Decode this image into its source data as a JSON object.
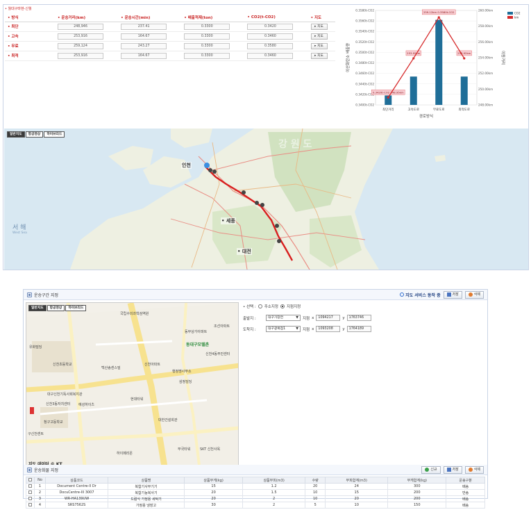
{
  "top": {
    "caption": "• 월대구마현-신월",
    "route_table": {
      "headers": [
        "• 방식",
        "• 운송거리(km)",
        "• 운송시간(min)",
        "• 배출적재(ton)",
        "• CO2(t-CO2)",
        "• 지도"
      ],
      "rows": [
        {
          "mode": "• 최단",
          "distance": "248,946",
          "time": "237.41",
          "load": "0.3300",
          "co2": "0.3420",
          "map": "▸ 지도"
        },
        {
          "mode": "• 고속",
          "distance": "253,916",
          "time": "164.67",
          "load": "0.3300",
          "co2": "0.3460",
          "map": "▸ 지도"
        },
        {
          "mode": "• 무료",
          "distance": "259,124",
          "time": "243.27",
          "load": "0.3300",
          "co2": "0.3580",
          "map": "▸ 지도"
        },
        {
          "mode": "• 최적",
          "distance": "253,916",
          "time": "164.67",
          "load": "0.3300",
          "co2": "0.3460",
          "map": "▸ 지도"
        }
      ]
    },
    "map_tabs": [
      "일반지도",
      "항공영상",
      "하이브리드"
    ],
    "map_labels": {
      "sea": "서 해",
      "sea_en": "West Sea",
      "incheon": "인천",
      "sejong": "• 세종",
      "daejeon": "• 대전",
      "watermark": "강 원 도"
    }
  },
  "chart_data": {
    "type": "bar",
    "categories": [
      "최단거리",
      "고속도로",
      "무료도로",
      "최적도로"
    ],
    "series": [
      {
        "name": "CO2",
        "type": "bar",
        "values": [
          0.342,
          0.346,
          0.358,
          0.346
        ],
        "color": "#1f6e98"
      },
      {
        "name": "km",
        "type": "line",
        "values": [
          248.946,
          253.916,
          259.124,
          253.916
        ],
        "color": "#d62728"
      }
    ],
    "xlabel": "경로방식",
    "ylabel": "이산화탄소 배출량",
    "y2label": "이동거리",
    "ylim": [
      0.34,
      0.36
    ],
    "y2lim": [
      248,
      260
    ],
    "yticks": [
      "0.3400t-CO2",
      "0.3420t-CO2",
      "0.3440t-CO2",
      "0.3460t-CO2",
      "0.3480t-CO2",
      "0.3500t-CO2",
      "0.3520t-CO2",
      "0.3540t-CO2",
      "0.3560t-CO2",
      "0.3580t-CO2"
    ],
    "y2ticks": [
      "248.00km",
      "250.00km",
      "252.00km",
      "254.00km",
      "256.00km",
      "258.00km",
      "260.00km"
    ],
    "data_labels": [
      "0.3420t-CO2 248.95km",
      "253.92km",
      "259.12km 0.3580t-CO2",
      "253.92km"
    ],
    "legend": [
      "CO2",
      "km"
    ],
    "legend_position": "top-right"
  },
  "route_section": {
    "title": "운송구간 지정",
    "sync_label": "지도 서비스 동작 중",
    "save_btn": "저장",
    "delete_btn": "삭제",
    "select_label": "• 선택 :",
    "radio_address": "주소지정",
    "radio_point": "지점지정",
    "origin_label": "출발지 :",
    "origin_select": "대구가창면",
    "origin_point": "지점",
    "origin_x": "1094217",
    "origin_y": "1763746",
    "dest_label": "도착지 :",
    "dest_select": "대구광복점1",
    "dest_point": "지점",
    "dest_x": "1093208",
    "dest_y": "1764189",
    "x_prefix": "x",
    "y_prefix": "y",
    "map_tabs": [
      "일반지도",
      "항공영상",
      "하이브리드"
    ],
    "copyright": "지도 데이터 © KT",
    "map_labels": [
      "동대구모텔촌",
      "유화빌딩",
      "신천초등학교",
      "대구신천기독사회복지관",
      "신천3동자치센터",
      "청구고등학교",
      "예성하이츠",
      "현대타워",
      "대한건설회관",
      "SKT 신천사옥",
      "부국타워",
      "하이페리온",
      "백산송센스빌",
      "국립수의과학검역원",
      "신천4동주민센터",
      "동부상가아파트",
      "조선아파트",
      "신천아파트",
      "행정명사무소",
      "삼정빌딩",
      "구신천센트"
    ]
  },
  "goods_section": {
    "title": "운송화물 지정",
    "new_btn": "신규",
    "save_btn": "저장",
    "delete_btn": "삭제",
    "headers": [
      "No",
      "상품코드",
      "상품명",
      "상품무게(kg)",
      "상품부피(m3)",
      "수량",
      "부피합계(m3)",
      "무게합계(kg)",
      "운송구분"
    ],
    "rows": [
      [
        "1",
        "Document Centre-II Dr",
        "복합기사무기기",
        "15",
        "1.2",
        "20",
        "24",
        "300",
        "배송"
      ],
      [
        "2",
        "DocuCentre-III 3007",
        "복합기능복사기",
        "20",
        "1.5",
        "10",
        "15",
        "200",
        "반송"
      ],
      [
        "3",
        "WR-HA139UW",
        "드럼식 가정용 세탁기",
        "20",
        "2",
        "10",
        "20",
        "200",
        "배송"
      ],
      [
        "4",
        "SRS7562S",
        "가정용 냉장고",
        "30",
        "2",
        "5",
        "10",
        "150",
        "배송"
      ]
    ]
  }
}
